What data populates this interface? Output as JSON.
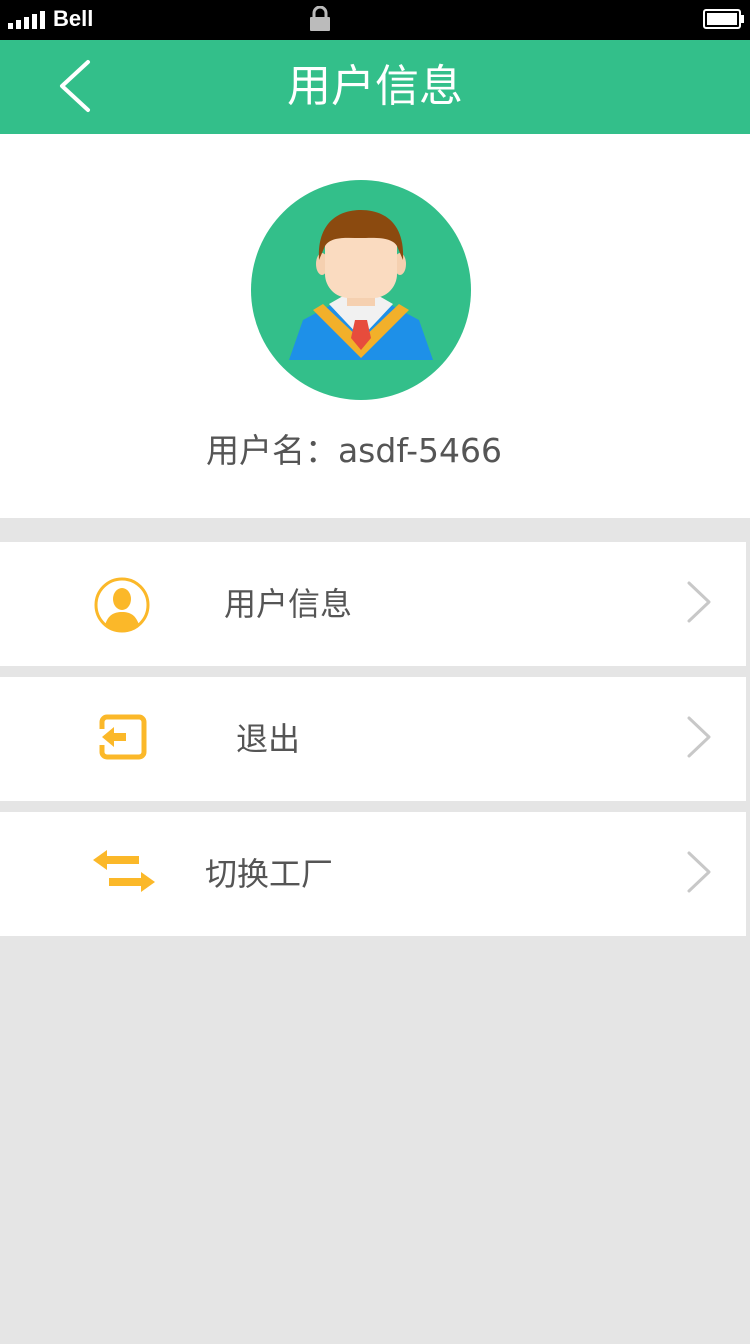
{
  "status_bar": {
    "carrier": "Bell"
  },
  "nav": {
    "title": "用户信息"
  },
  "profile": {
    "username": "用户名：asdf-5466"
  },
  "menu": {
    "items": [
      {
        "label": "用户信息",
        "icon": "user-icon"
      },
      {
        "label": "退出",
        "icon": "logout-icon"
      },
      {
        "label": "切换工厂",
        "icon": "switch-icon"
      }
    ]
  },
  "colors": {
    "primary": "#33bf8a",
    "accent": "#fbb829",
    "background": "#e5e5e5"
  }
}
